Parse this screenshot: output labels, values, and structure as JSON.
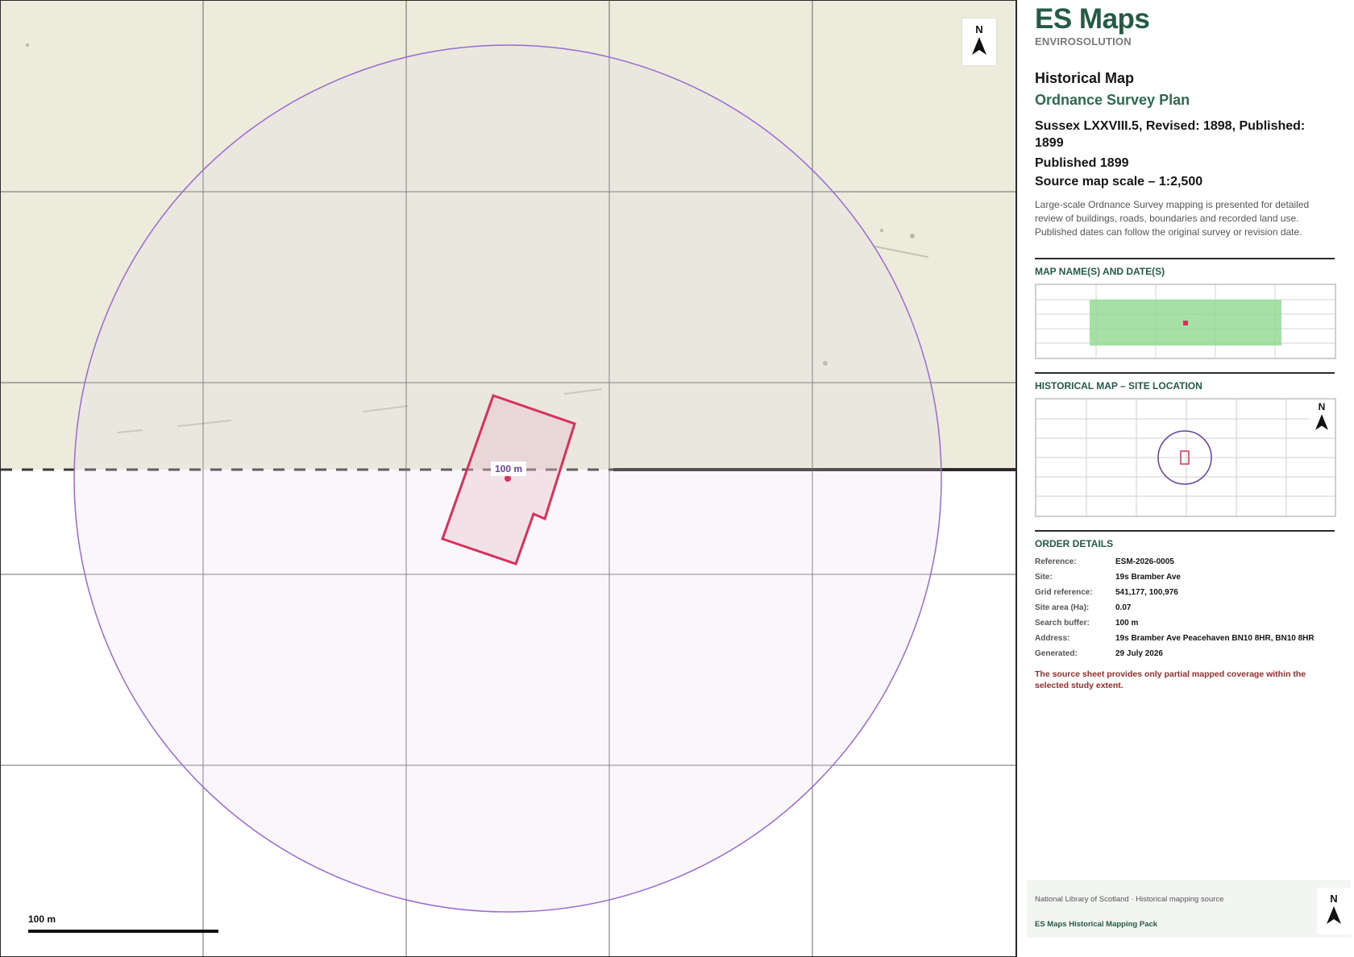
{
  "map": {
    "north_label": "N",
    "buffer_label": "100 m",
    "scale_label": "100 m",
    "colors": {
      "paper": "#ecebdc",
      "buffer_outline": "#9a6ad2",
      "buffer_fill": "#f3f0f8",
      "site_outline": "#d6325a",
      "grid": "#4a4a4a"
    }
  },
  "brand": {
    "title": "ES Maps",
    "subtitle": "ENVIROSOLUTION"
  },
  "header": {
    "title": "Historical Map",
    "map_type": "Ordnance Survey Plan",
    "sheet": "Sussex LXXVIII.5, Revised: 1898, Published: 1899",
    "published": "Published 1899",
    "scale": "Source map scale – 1:2,500",
    "description": "Large-scale Ordnance Survey mapping is presented for detailed review of buildings, roads, boundaries and recorded land use. Published dates can follow the original survey or revision date."
  },
  "sections": {
    "map_names": "MAP NAME(S) AND DATE(S)",
    "site_location": "HISTORICAL MAP – SITE LOCATION",
    "order_details": "ORDER DETAILS"
  },
  "inset_north": "N",
  "order_details": [
    {
      "key": "Reference:",
      "value": "ESM-2026-0005"
    },
    {
      "key": "Site:",
      "value": "19s Bramber Ave"
    },
    {
      "key": "Grid reference:",
      "value": "541,177, 100,976"
    },
    {
      "key": "Site area (Ha):",
      "value": "0.07"
    },
    {
      "key": "Search buffer:",
      "value": "100 m"
    },
    {
      "key": "Address:",
      "value": "19s Bramber Ave Peacehaven BN10 8HR, BN10 8HR"
    },
    {
      "key": "Generated:",
      "value": "29 July 2026"
    }
  ],
  "warning": "The source sheet provides only partial mapped coverage within the selected study extent.",
  "footer": {
    "source": "National Library of Scotland · Historical mapping source",
    "pack": "ES Maps Historical Mapping Pack",
    "north_label": "N"
  }
}
